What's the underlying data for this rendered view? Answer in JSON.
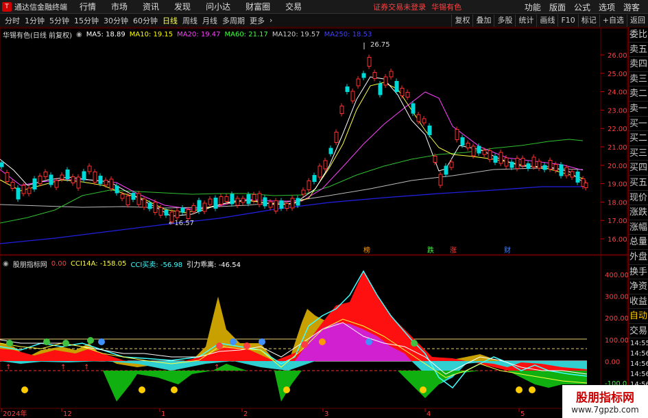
{
  "app": {
    "title": "通达信金融终端",
    "menu": [
      "行情",
      "市场",
      "资讯",
      "发现",
      "问小达",
      "财富圈",
      "交易"
    ],
    "status": "证券交易未登录",
    "stock": "华锡有色",
    "right_menu": [
      "功能",
      "版面",
      "公式",
      "选项",
      "游客"
    ]
  },
  "toolbar": {
    "periods": [
      "分时",
      "1分钟",
      "5分钟",
      "15分钟",
      "30分钟",
      "60分钟",
      "日线",
      "周线",
      "月线",
      "多周期",
      "更多"
    ],
    "active_period": "日线",
    "buttons": [
      "复权",
      "叠加",
      "多股",
      "统计",
      "画线",
      "F10",
      "标记",
      "+自选",
      "返回"
    ]
  },
  "main_legend": {
    "stock": "华锡有色(日线 前复权)",
    "ma": [
      {
        "label": "MA5: 18.89",
        "color": "#ffffff"
      },
      {
        "label": "MA10: 19.15",
        "color": "#ffff00"
      },
      {
        "label": "MA20: 19.47",
        "color": "#ff40ff"
      },
      {
        "label": "MA60: 21.17",
        "color": "#40ff40"
      },
      {
        "label": "MA120: 19.57",
        "color": "#cccccc"
      },
      {
        "label": "MA250: 18.53",
        "color": "#4040ff"
      }
    ]
  },
  "price_axis": [
    "26.00",
    "25.00",
    "24.00",
    "23.00",
    "22.00",
    "21.00",
    "20.00",
    "19.00",
    "18.00",
    "17.00",
    "16.00"
  ],
  "annotations": {
    "high": "26.75",
    "low": "16.57"
  },
  "event_tags": [
    {
      "text": "榜",
      "color": "#ff9900"
    },
    {
      "text": "跌",
      "color": "#40ff40"
    },
    {
      "text": "涨",
      "color": "#ff4040"
    },
    {
      "text": "财",
      "color": "#4080ff"
    }
  ],
  "indicator_legend": {
    "name": "股朋指标网",
    "items": [
      {
        "label": "0.00",
        "color": "#ff4040"
      },
      {
        "label": "CCI14A: -158.05",
        "color": "#ffff40"
      },
      {
        "label": "CCI买卖: -56.98",
        "color": "#40ffff"
      },
      {
        "label": "引力乖离: -46.54",
        "color": "#ffffff"
      }
    ]
  },
  "indicator_axis": [
    "400.00",
    "300.00",
    "200.00",
    "100.00",
    "0.00",
    "-100.0"
  ],
  "time_axis": [
    "2024年",
    "12",
    "1",
    "2",
    "3",
    "4",
    "5"
  ],
  "sidebar": {
    "items": [
      "委比",
      "卖五",
      "卖四",
      "卖三",
      "卖二",
      "卖一",
      "买一",
      "买二",
      "买三",
      "买四",
      "买五",
      "现价",
      "涨跌",
      "涨幅",
      "总量",
      "外盘",
      "换手",
      "净资",
      "收益"
    ],
    "highlight": "自动",
    "trade": "交易",
    "times": [
      "14:55",
      "14:56",
      "14:56",
      "14:56",
      "14:56",
      "14:56",
      "14:56",
      "14:56"
    ]
  },
  "watermark": {
    "title": "股朋指标网",
    "url": "www.7gpzb.com"
  },
  "colors": {
    "up": "#ff3030",
    "down": "#00d8d8",
    "bg": "#000000"
  }
}
